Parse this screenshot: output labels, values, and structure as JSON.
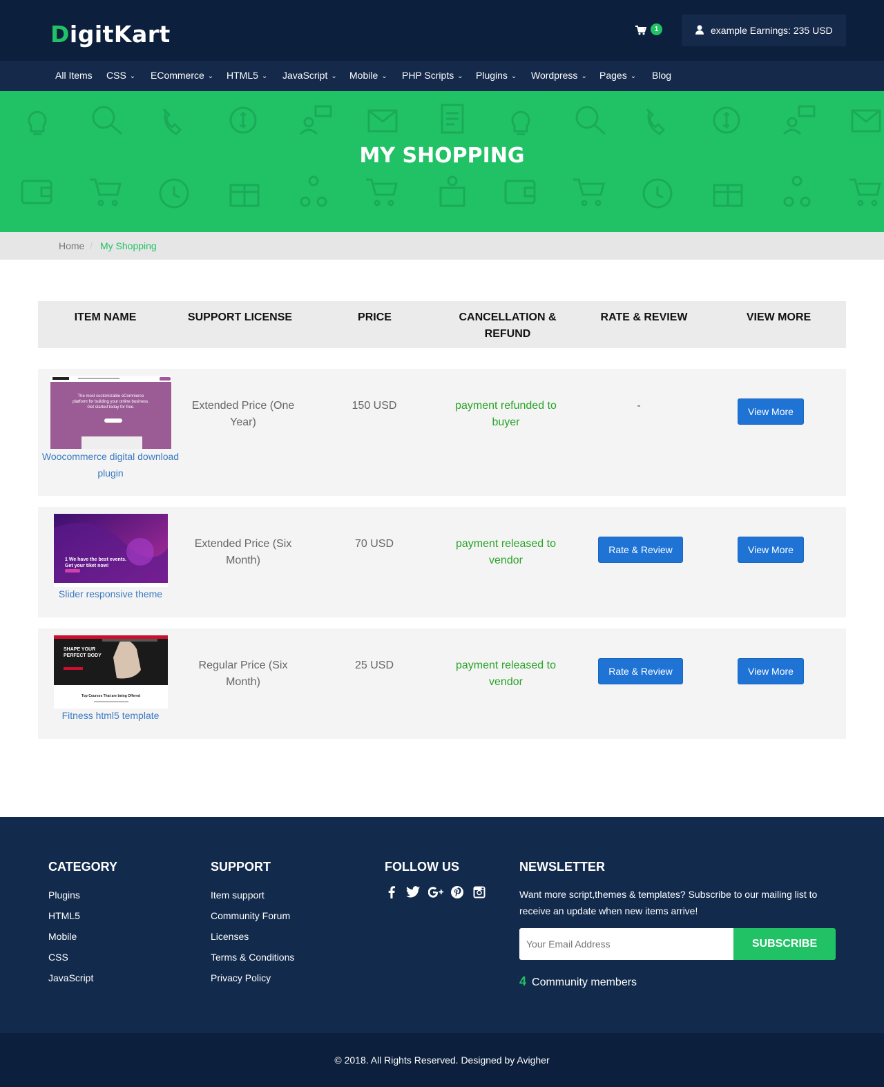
{
  "header": {
    "logo_first": "D",
    "logo_rest": "igitKart",
    "cart_count": "1",
    "account_label": "example Earnings: 235 USD"
  },
  "nav": {
    "items": [
      {
        "label": "All Items",
        "dropdown": false
      },
      {
        "label": "CSS",
        "dropdown": true
      },
      {
        "label": "ECommerce",
        "dropdown": true
      },
      {
        "label": "HTML5",
        "dropdown": true
      },
      {
        "label": "JavaScript",
        "dropdown": true
      },
      {
        "label": "Mobile",
        "dropdown": true
      },
      {
        "label": "PHP Scripts",
        "dropdown": true
      },
      {
        "label": "Plugins",
        "dropdown": true
      },
      {
        "label": "Wordpress",
        "dropdown": true
      },
      {
        "label": "Pages",
        "dropdown": true
      },
      {
        "label": "Blog",
        "dropdown": false
      }
    ]
  },
  "hero": {
    "title": "MY SHOPPING"
  },
  "breadcrumb": {
    "home": "Home",
    "separator": "/",
    "current": "My Shopping"
  },
  "table": {
    "headers": [
      "ITEM NAME",
      "SUPPORT LICENSE",
      "PRICE",
      "CANCELLATION & REFUND",
      "RATE & REVIEW",
      "VIEW MORE"
    ],
    "rows": [
      {
        "item_name": "Woocommerce digital download plugin",
        "license": "Extended Price (One Year)",
        "price": "150 USD",
        "status": "payment refunded to buyer",
        "rate": "-",
        "rate_button": null,
        "view_button": "View More"
      },
      {
        "item_name": "Slider responsive theme",
        "license": "Extended Price (Six Month)",
        "price": "70 USD",
        "status": "payment released to vendor",
        "rate": null,
        "rate_button": "Rate & Review",
        "view_button": "View More"
      },
      {
        "item_name": "Fitness html5 template",
        "license": "Regular Price (Six Month)",
        "price": "25 USD",
        "status": "payment released to vendor",
        "rate": null,
        "rate_button": "Rate & Review",
        "view_button": "View More"
      }
    ],
    "thumb_text": {
      "thumb1_line1": "The most customizable eCommerce",
      "thumb1_line2": "platform for building your online business.",
      "thumb1_line3": "Get started today for free.",
      "thumb2_line1": "1 We have the best events.",
      "thumb2_line2": "Get your tiket now!",
      "thumb3_line1": "SHAPE YOUR",
      "thumb3_line2": "PERFECT BODY",
      "thumb3_line3": "Top Courses That are being Offered"
    }
  },
  "footer": {
    "category": {
      "title": "CATEGORY",
      "links": [
        "Plugins",
        "HTML5",
        "Mobile",
        "CSS",
        "JavaScript"
      ]
    },
    "support": {
      "title": "SUPPORT",
      "links": [
        "Item support",
        "Community Forum",
        "Licenses",
        "Terms & Conditions",
        "Privacy Policy"
      ]
    },
    "follow": {
      "title": "FOLLOW US",
      "icons": [
        "facebook-icon",
        "twitter-icon",
        "google-plus-icon",
        "pinterest-icon",
        "instagram-icon"
      ]
    },
    "newsletter": {
      "title": "NEWSLETTER",
      "text": "Want more script,themes & templates? Subscribe to our mailing list to receive an update when new items arrive!",
      "placeholder": "Your Email Address",
      "button": "SUBSCRIBE",
      "community_count": "4",
      "community_label": "Community members"
    },
    "copyright": "© 2018. All Rights Reserved. Designed by Avigher"
  },
  "colors": {
    "brand_green": "#21c266",
    "header_navy": "#0c203d",
    "nav_navy": "#15294a",
    "button_blue": "#1e73d5"
  }
}
